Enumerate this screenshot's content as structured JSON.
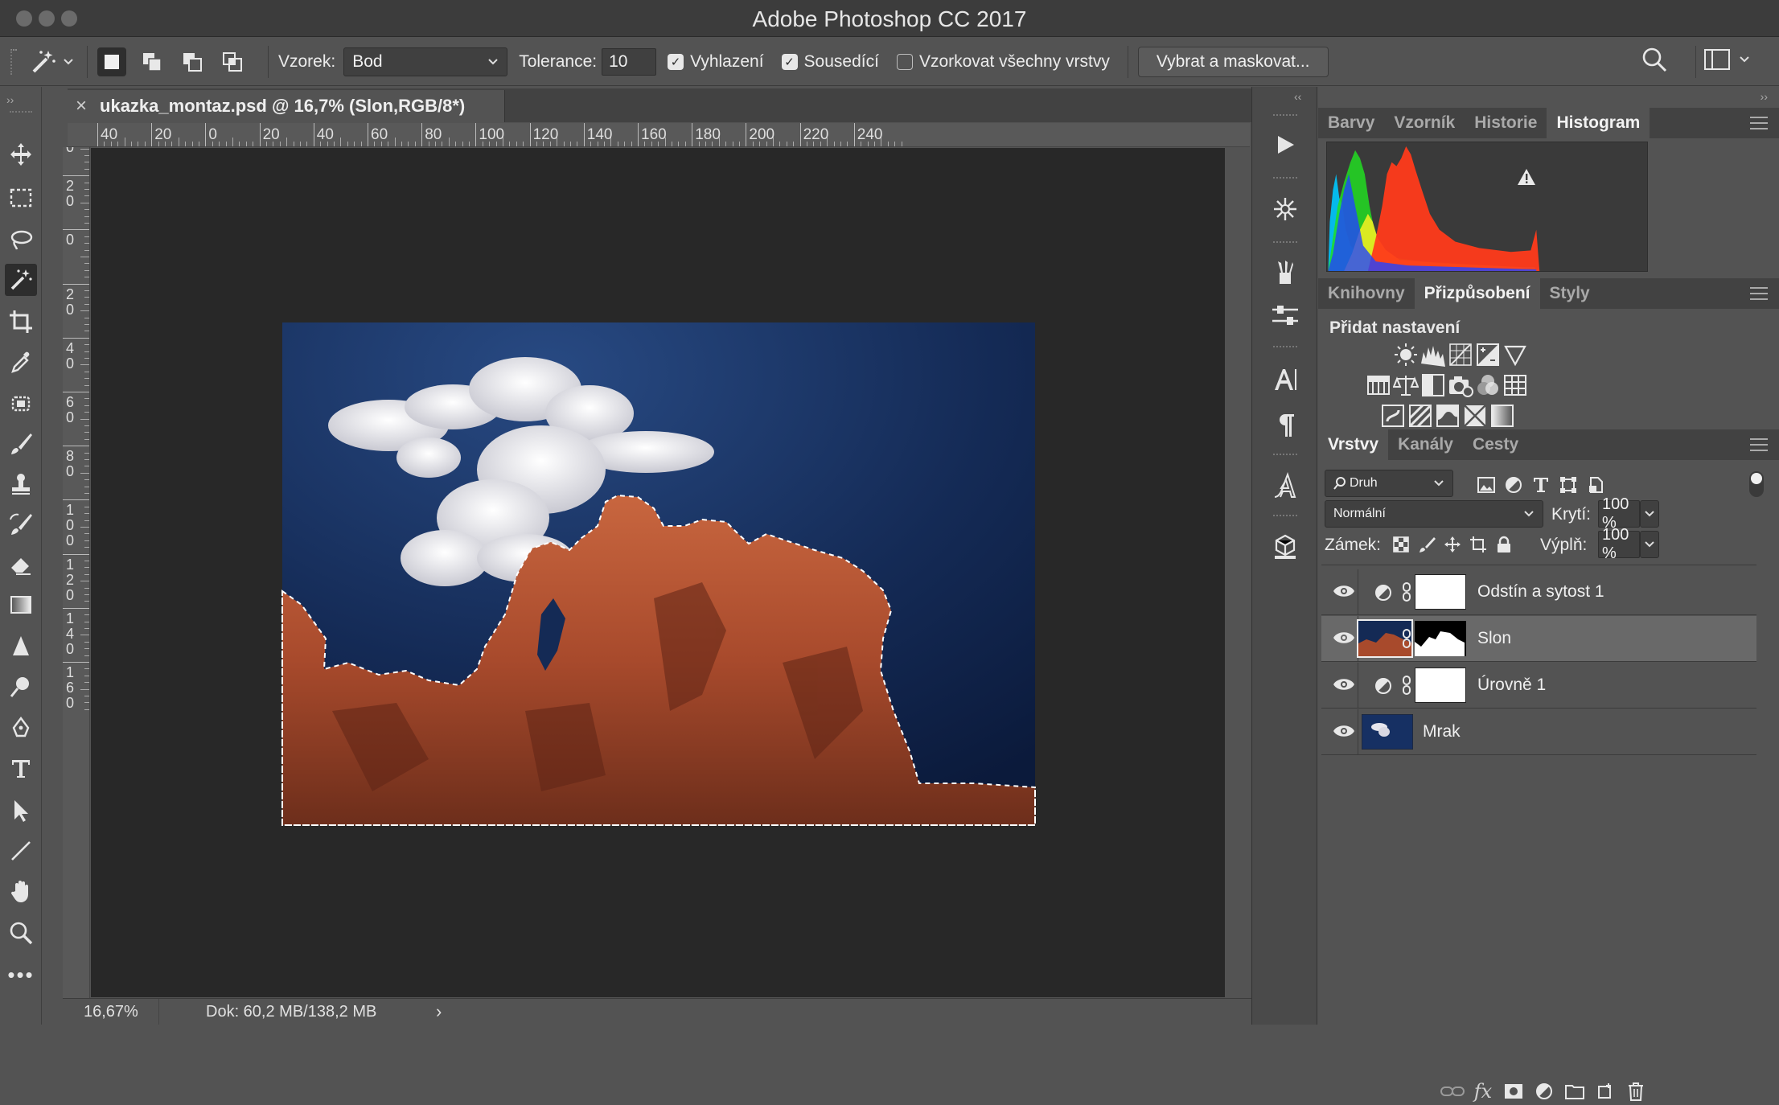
{
  "window": {
    "title": "Adobe Photoshop CC 2017"
  },
  "options": {
    "sample_label": "Vzorek:",
    "sample_value": "Bod",
    "tolerance_label": "Tolerance:",
    "tolerance_value": "10",
    "antialias_label": "Vyhlazení",
    "antialias_checked": true,
    "contiguous_label": "Sousedící",
    "contiguous_checked": true,
    "all_layers_label": "Vzorkovat všechny vrstvy",
    "all_layers_checked": false,
    "select_mask_label": "Vybrat a maskovat..."
  },
  "document": {
    "tab_title": "ukazka_montaz.psd @ 16,7% (Slon,RGB/8*)",
    "close_glyph": "×"
  },
  "ruler": {
    "h_ticks": [
      "40",
      "20",
      "0",
      "20",
      "40",
      "60",
      "80",
      "100",
      "120",
      "140",
      "160",
      "180",
      "200",
      "220",
      "240"
    ],
    "v_ticks": [
      "40",
      "20",
      "0",
      "20",
      "40",
      "60",
      "80",
      "100",
      "120",
      "140",
      "160"
    ]
  },
  "status": {
    "zoom": "16,67%",
    "doc_info": "Dok: 60,2 MB/138,2 MB",
    "arrow": "›"
  },
  "panels": {
    "top_tabs": [
      "Barvy",
      "Vzorník",
      "Historie",
      "Histogram"
    ],
    "top_active": 3,
    "mid_tabs": [
      "Knihovny",
      "Přizpůsobení",
      "Styly"
    ],
    "mid_active": 1,
    "adjust_title": "Přidat nastavení",
    "layer_tabs": [
      "Vrstvy",
      "Kanály",
      "Cesty"
    ],
    "layer_active": 0
  },
  "layers_panel": {
    "filter_label": "Druh",
    "blend_mode": "Normální",
    "opacity_label": "Krytí:",
    "opacity_value": "100 %",
    "lock_label": "Zámek:",
    "fill_label": "Výplň:",
    "fill_value": "100 %",
    "layers": [
      {
        "name": "Odstín a sytost 1",
        "kind": "adjustment",
        "visible": true,
        "selected": false
      },
      {
        "name": "Slon",
        "kind": "pixel-with-mask",
        "visible": true,
        "selected": true
      },
      {
        "name": "Úrovně 1",
        "kind": "adjustment",
        "visible": true,
        "selected": false
      },
      {
        "name": "Mrak",
        "kind": "pixel",
        "visible": true,
        "selected": false
      }
    ]
  },
  "colors": {
    "bg": "#535353",
    "canvas": "#282828",
    "selected_layer": "#696969",
    "sky": "#142a55",
    "rock": "#a84a2c"
  }
}
